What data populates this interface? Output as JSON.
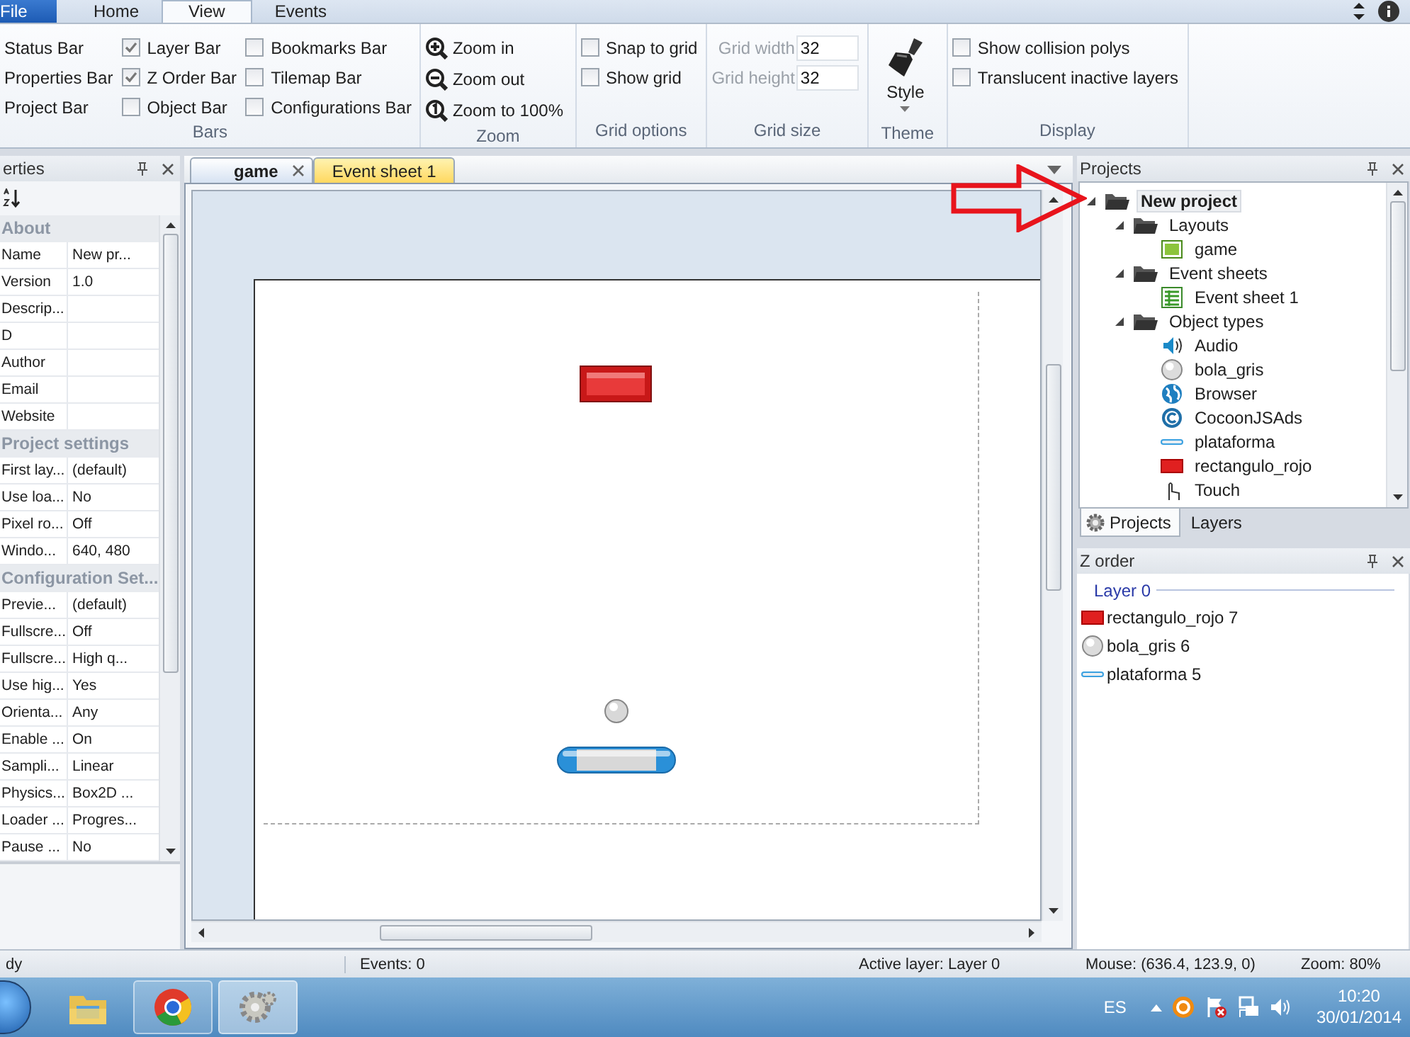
{
  "ribbon": {
    "tabs": [
      {
        "label": "File",
        "kind": "file",
        "selected": false
      },
      {
        "label": "Home",
        "kind": "tab",
        "selected": false
      },
      {
        "label": "View",
        "kind": "tab",
        "selected": true
      },
      {
        "label": "Events",
        "kind": "tab",
        "selected": false
      }
    ],
    "groups": [
      {
        "title": "Bars",
        "columns": [
          [
            {
              "kind": "label",
              "label": "Status Bar"
            },
            {
              "kind": "label",
              "label": "Properties Bar"
            },
            {
              "kind": "label",
              "label": "Project Bar"
            }
          ],
          [
            {
              "kind": "check",
              "label": "Layer Bar",
              "checked": true
            },
            {
              "kind": "check",
              "label": "Z Order Bar",
              "checked": true
            },
            {
              "kind": "check",
              "label": "Object Bar",
              "checked": false
            }
          ],
          [
            {
              "kind": "check",
              "label": "Bookmarks Bar",
              "checked": false
            },
            {
              "kind": "check",
              "label": "Tilemap Bar",
              "checked": false
            },
            {
              "kind": "check",
              "label": "Configurations Bar",
              "checked": false
            }
          ]
        ]
      },
      {
        "title": "Zoom",
        "columns": [
          [
            {
              "kind": "tool",
              "label": "Zoom in"
            },
            {
              "kind": "tool",
              "label": "Zoom out"
            },
            {
              "kind": "tool",
              "label": "Zoom to 100%"
            }
          ]
        ]
      },
      {
        "title": "Grid options",
        "columns": [
          [
            {
              "kind": "check",
              "label": "Snap to grid",
              "checked": false
            },
            {
              "kind": "check",
              "label": "Show grid",
              "checked": false
            }
          ]
        ]
      },
      {
        "title": "Grid size",
        "columns": [
          [
            {
              "kind": "number",
              "label": "Grid width",
              "value": "32",
              "disabled": true
            },
            {
              "kind": "number",
              "label": "Grid height",
              "value": "32",
              "disabled": true
            }
          ]
        ]
      },
      {
        "title": "Theme",
        "columns": [
          [
            {
              "kind": "big",
              "label": "Style"
            }
          ]
        ]
      },
      {
        "title": "Display",
        "columns": [
          [
            {
              "kind": "check",
              "label": "Show collision polys",
              "checked": false
            },
            {
              "kind": "check",
              "label": "Translucent inactive layers",
              "checked": false
            }
          ]
        ]
      }
    ]
  },
  "properties": {
    "title": "erties",
    "sections": [
      {
        "title": "About",
        "rows": [
          {
            "name": "Name",
            "value": "New pr..."
          },
          {
            "name": "Version",
            "value": "1.0"
          },
          {
            "name": "Descrip..."
          },
          {
            "name": "D"
          },
          {
            "name": "Author"
          },
          {
            "name": "Email"
          },
          {
            "name": "Website"
          }
        ]
      },
      {
        "title": "Project settings",
        "rows": [
          {
            "name": "First lay...",
            "value": "(default)"
          },
          {
            "name": "Use loa...",
            "value": "No"
          },
          {
            "name": "Pixel ro...",
            "value": "Off"
          },
          {
            "name": "Windo...",
            "value": "640, 480"
          }
        ]
      },
      {
        "title": "Configuration Set...",
        "rows": [
          {
            "name": "Previe...",
            "value": "(default)"
          },
          {
            "name": "Fullscre...",
            "value": "Off"
          },
          {
            "name": "Fullscre...",
            "value": "High q..."
          },
          {
            "name": "Use hig...",
            "value": "Yes"
          },
          {
            "name": "Orienta...",
            "value": "Any"
          },
          {
            "name": "Enable ...",
            "value": "On"
          },
          {
            "name": "Sampli...",
            "value": "Linear"
          },
          {
            "name": "Physics...",
            "value": "Box2D ..."
          },
          {
            "name": "Loader ...",
            "value": "Progres..."
          },
          {
            "name": "Pause ...",
            "value": "No"
          }
        ]
      }
    ]
  },
  "documents": {
    "tabs": [
      {
        "label": "game",
        "kind": "layout",
        "selected": true
      },
      {
        "label": "Event sheet 1",
        "kind": "eventsheet",
        "selected": false
      }
    ],
    "objects": [
      {
        "kind": "block"
      },
      {
        "kind": "ball"
      },
      {
        "kind": "platform"
      }
    ]
  },
  "projects": {
    "title": "Projects",
    "tree": [
      {
        "label": "New project",
        "kind": "project",
        "expanded": true,
        "selected": true,
        "children": [
          {
            "label": "Layouts",
            "kind": "folder",
            "expanded": true,
            "selected": false,
            "children": [
              {
                "label": "game",
                "kind": "layout",
                "selected": false
              }
            ]
          },
          {
            "label": "Event sheets",
            "kind": "folder",
            "expanded": true,
            "selected": false,
            "children": [
              {
                "label": "Event sheet 1",
                "kind": "eventsheet",
                "selected": false
              }
            ]
          },
          {
            "label": "Object types",
            "kind": "folder",
            "expanded": true,
            "selected": false,
            "children": [
              {
                "label": "Audio",
                "kind": "audio",
                "selected": false
              },
              {
                "label": "bola_gris",
                "kind": "ball",
                "selected": false
              },
              {
                "label": "Browser",
                "kind": "browser",
                "selected": false
              },
              {
                "label": "CocoonJSAds",
                "kind": "plugin",
                "selected": false
              },
              {
                "label": "plataforma",
                "kind": "platform",
                "selected": false
              },
              {
                "label": "rectangulo_rojo",
                "kind": "block",
                "selected": false
              },
              {
                "label": "Touch",
                "kind": "touch",
                "selected": false
              }
            ]
          }
        ]
      }
    ],
    "tabs": [
      {
        "label": "Projects",
        "selected": true
      },
      {
        "label": "Layers",
        "selected": false
      }
    ]
  },
  "zorder": {
    "title": "Z order",
    "layer": "Layer 0",
    "items": [
      {
        "label": "rectangulo_rojo 7",
        "kind": "block"
      },
      {
        "label": "bola_gris 6",
        "kind": "ball"
      },
      {
        "label": "plataforma 5",
        "kind": "platform"
      }
    ]
  },
  "status_bar": [
    "dy",
    "Events: 0",
    "Active layer: Layer 0",
    "Mouse: (636.4, 123.9, 0)",
    "Zoom: 80%"
  ],
  "taskbar": {
    "apps": [
      {
        "kind": "folder",
        "running": false,
        "selected": false
      },
      {
        "kind": "browser",
        "running": true,
        "selected": false
      },
      {
        "kind": "gear",
        "running": true,
        "selected": true
      }
    ],
    "language": "ES",
    "time": "10:20",
    "date": "30/01/2014"
  }
}
